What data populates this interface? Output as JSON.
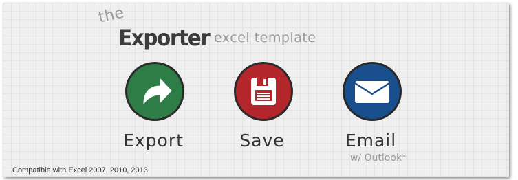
{
  "header": {
    "prefix": "the",
    "brand": "Exporter",
    "tagline": "excel template"
  },
  "actions": [
    {
      "label": "Export",
      "icon": "export-arrow-icon",
      "color": "#2e7d46"
    },
    {
      "label": "Save",
      "icon": "floppy-disk-icon",
      "color": "#b3262b"
    },
    {
      "label": "Email",
      "sublabel": "w/ Outlook*",
      "icon": "envelope-icon",
      "color": "#1a4f8e"
    }
  ],
  "footer": {
    "compatibility": "Compatible with Excel 2007, 2010, 2013"
  }
}
